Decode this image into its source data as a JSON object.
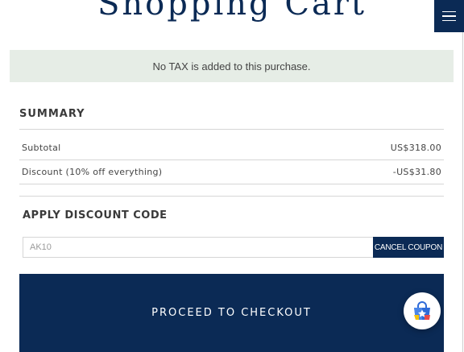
{
  "header": {
    "title": "Shopping Cart",
    "menu_icon": "hamburger-menu-icon"
  },
  "notice": {
    "text": "No TAX is added to this purchase.",
    "background": "#e6ede6"
  },
  "summary": {
    "heading": "SUMMARY",
    "rows": [
      {
        "label": "Subtotal",
        "value": "US$318.00"
      },
      {
        "label": "Discount (10% off everything)",
        "value": "-US$31.80"
      }
    ]
  },
  "discount": {
    "heading": "APPLY DISCOUNT CODE",
    "code_value": "AK10",
    "cancel_label": "CANCEL COUPON"
  },
  "checkout": {
    "label": "PROCEED TO CHECKOUT"
  },
  "widget": {
    "icon": "shopping-bag-star-icon"
  },
  "colors": {
    "brand_navy": "#0b2a55"
  }
}
